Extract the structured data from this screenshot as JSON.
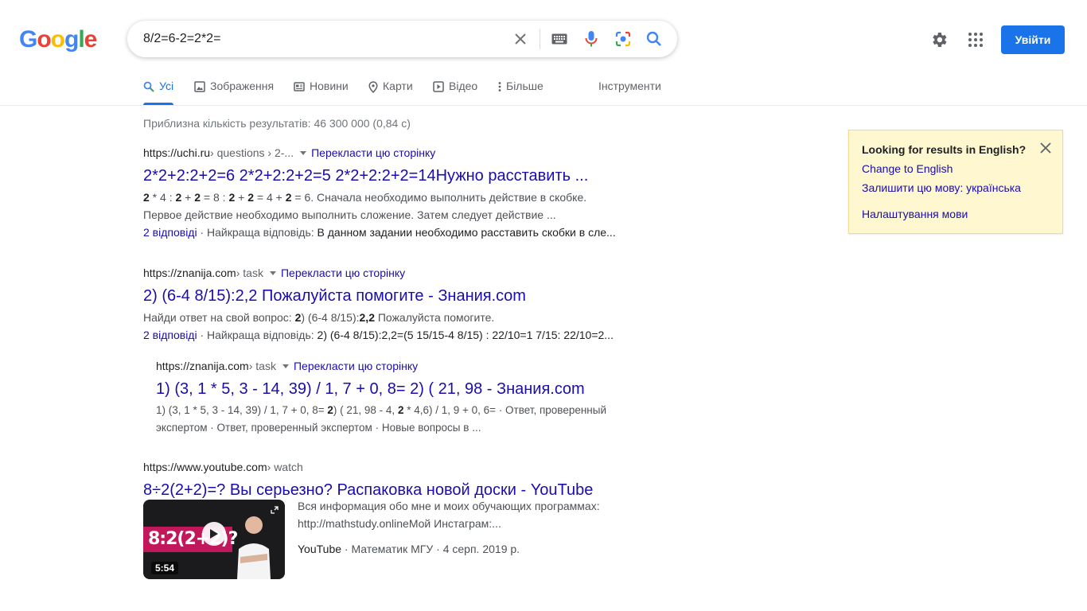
{
  "logo": {
    "letters": [
      "G",
      "o",
      "o",
      "g",
      "l",
      "e"
    ]
  },
  "search": {
    "value": "8/2=6-2=2*2="
  },
  "header": {
    "signin_label": "Увійти"
  },
  "tabs": [
    {
      "label": "Усі",
      "icon": "search-icon",
      "active": true
    },
    {
      "label": "Зображення",
      "icon": "image-icon"
    },
    {
      "label": "Новини",
      "icon": "news-icon"
    },
    {
      "label": "Карти",
      "icon": "map-pin-icon"
    },
    {
      "label": "Відео",
      "icon": "video-icon"
    },
    {
      "label": "Більше",
      "icon": "more-vert-icon"
    },
    {
      "label": "Інструменти"
    }
  ],
  "stats": "Приблизна кількість результатів: 46 300 000 (0,84 с)",
  "results": [
    {
      "url": "https://uchi.ru",
      "path": " › questions › 2-...",
      "translate": "Перекласти цю сторінку",
      "title": "2*2+2:2+2=6 2*2+2:2+2=5 2*2+2:2+2=14Нужно расставить ...",
      "snippet_line1_parts": [
        "2",
        " * 4 : ",
        "2",
        " + ",
        "2",
        " = 8 : ",
        "2",
        " + ",
        "2",
        " = 4 + ",
        "2",
        " = 6. Сначала необходимо выполнить действие в скобке."
      ],
      "snippet_line2": "Первое действие необходимо выполнить сложение. Затем следует действие ...",
      "answers": "2 відповіді",
      "best_label": " · Найкраща відповідь: ",
      "best_text": "В данном задании необходимо расставить скобки в сле..."
    },
    {
      "url": "https://znanija.com",
      "path": " › task",
      "translate": "Перекласти цю сторінку",
      "title": "2) (6-4 8/15):2,2 Пожалуйста помогите - Знания.com",
      "snippet_prefix": "Найди ответ на свой вопрос: ",
      "snippet_b1": "2",
      "snippet_mid": ") (6-4 8/15):",
      "snippet_b2": "2,2",
      "snippet_suffix": " Пожалуйста помогите.",
      "answers": "2 відповіді",
      "best_label": " · Найкраща відповідь: ",
      "best_text": "2) (6-4 8/15):2,2=(5 15/15-4 8/15) : 22/10=1 7/15: 22/10=2..."
    },
    {
      "url": "https://znanija.com",
      "path": " › task",
      "translate": "Перекласти цю сторінку",
      "title": "1) (3, 1 * 5, 3 - 14, 39) / 1, 7 + 0, 8= 2) ( 21, 98 - Знания.com",
      "snippet_a": "1) (3, 1 * 5, 3 - 14, 39) / 1, 7 + 0, 8= ",
      "snippet_b1": "2",
      "snippet_c": ") ( 21, 98 - 4, ",
      "snippet_b2": "2",
      "snippet_d": " * 4,6) / 1, 9 + 0, 6= · Ответ, проверенный",
      "snippet_line2": "экспертом · Ответ, проверенный экспертом · Новые вопросы в ..."
    },
    {
      "url": "https://www.youtube.com",
      "path": " › watch",
      "title": "8÷2(2+2)=? Вы серьезно? Распаковка новой доски - YouTube",
      "thumb_text": "8:2(2+2)?",
      "duration": "5:54",
      "desc_line1": "Вся информация обо мне и моих обучающих программах:",
      "desc_line2": "http://mathstudy.onlineМой Инстаграм:...",
      "source": "YouTube",
      "meta": " · Математик МГУ · 4 серп. 2019 р."
    }
  ],
  "langbox": {
    "title": "Looking for results in English?",
    "change": "Change to English",
    "keep": "Залишити цю мову: українська",
    "settings": "Налаштування мови"
  },
  "colors": {
    "link": "#1a0dab",
    "accent": "#1a73e8",
    "langbox_bg": "#fef7cf"
  }
}
